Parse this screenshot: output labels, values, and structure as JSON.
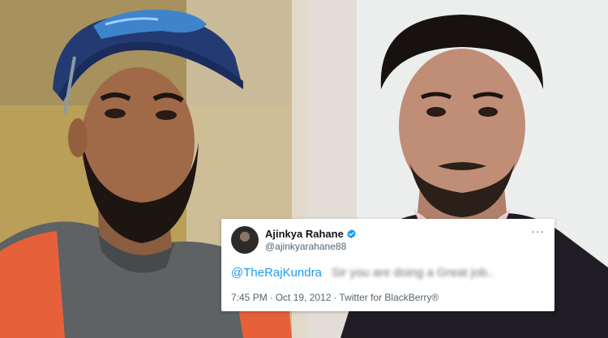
{
  "tweet": {
    "display_name": "Ajinkya Rahane",
    "handle": "@ajinkyarahane88",
    "mention": "@TheRajKundra",
    "blurred_text": "Sir you are doing a Great job..",
    "time": "7:45 PM",
    "separator": "·",
    "date": "Oct 19, 2012",
    "source": "Twitter for BlackBerry®",
    "more_icon": "···",
    "verified_icon": "verified-badge-icon",
    "mention_color": "#1d9bf0"
  }
}
